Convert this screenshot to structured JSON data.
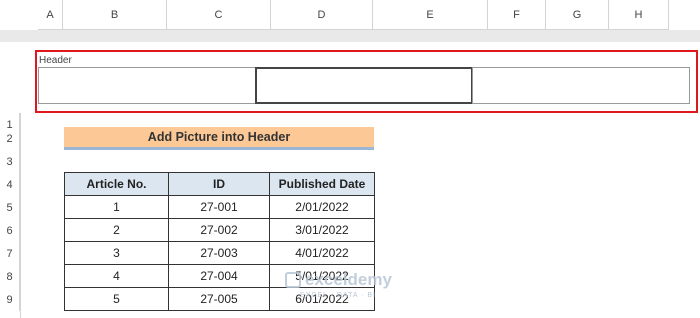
{
  "columns": [
    "A",
    "B",
    "C",
    "D",
    "E",
    "F",
    "G",
    "H"
  ],
  "rows": [
    "1",
    "2",
    "3",
    "4",
    "5",
    "6",
    "7",
    "8",
    "9"
  ],
  "header_section": {
    "label": "Header"
  },
  "title": "Add Picture into Header",
  "table": {
    "headers": [
      "Article No.",
      "ID",
      "Published Date"
    ],
    "rows": [
      [
        "1",
        "27-001",
        "2/01/2022"
      ],
      [
        "2",
        "27-002",
        "3/01/2022"
      ],
      [
        "3",
        "27-003",
        "4/01/2022"
      ],
      [
        "4",
        "27-004",
        "5/01/2022"
      ],
      [
        "5",
        "27-005",
        "6/01/2022"
      ]
    ]
  },
  "watermark": {
    "name": "exceldemy",
    "tagline": "EXCEL · DATA · BI"
  },
  "colors": {
    "highlight": "#e0171c",
    "title_fill": "#fbc896",
    "header_fill": "#dce6f1"
  }
}
